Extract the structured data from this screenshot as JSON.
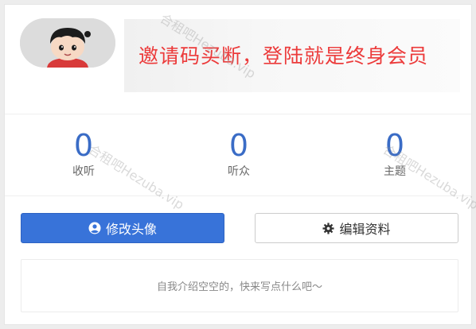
{
  "banner": {
    "text": "邀请码买断，登陆就是终身会员",
    "color": "#ec3b3b"
  },
  "avatar": {
    "alt": "cartoon-boy-avatar"
  },
  "stats": [
    {
      "value": "0",
      "label": "收听"
    },
    {
      "value": "0",
      "label": "听众"
    },
    {
      "value": "0",
      "label": "主题"
    }
  ],
  "buttons": {
    "edit_avatar": {
      "label": "修改头像",
      "icon": "user-circle-icon",
      "color": "#3873d9"
    },
    "edit_profile": {
      "label": "编辑资料",
      "icon": "gear-icon"
    }
  },
  "intro": {
    "placeholder": "自我介绍空空的，快来写点什么吧～"
  },
  "watermark": {
    "text": "合租吧Hezuba.vip"
  },
  "colors": {
    "accent": "#3a6cc6",
    "background": "#ededed"
  }
}
